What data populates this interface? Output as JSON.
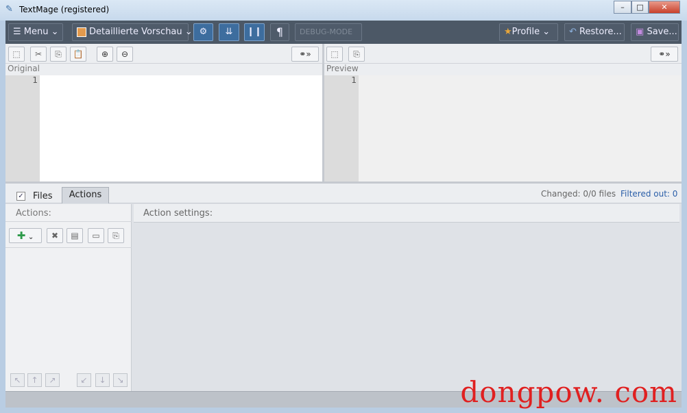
{
  "window": {
    "title": "TextMage (registered)",
    "minimize": "–",
    "maximize": "□",
    "close": "✕"
  },
  "toolbar": {
    "menu": "☰ Menu ⌄",
    "view": "Detaillierte Vorschau ⌄",
    "debug": "DEBUG-MODE",
    "profile": "Profile ⌄",
    "restore": "Restore...",
    "save": "Save...",
    "pilcrow": "¶"
  },
  "original": {
    "label": "Original",
    "line": "1"
  },
  "preview": {
    "label": "Preview",
    "line": "1"
  },
  "tabs": {
    "files": "Files",
    "actions": "Actions",
    "files_checked": true
  },
  "status": {
    "changed": "Changed: 0/0 files",
    "filtered": "Filtered out: 0"
  },
  "actions": {
    "label": "Actions:",
    "settings": "Action settings:"
  },
  "watermark": "dongpow. com"
}
